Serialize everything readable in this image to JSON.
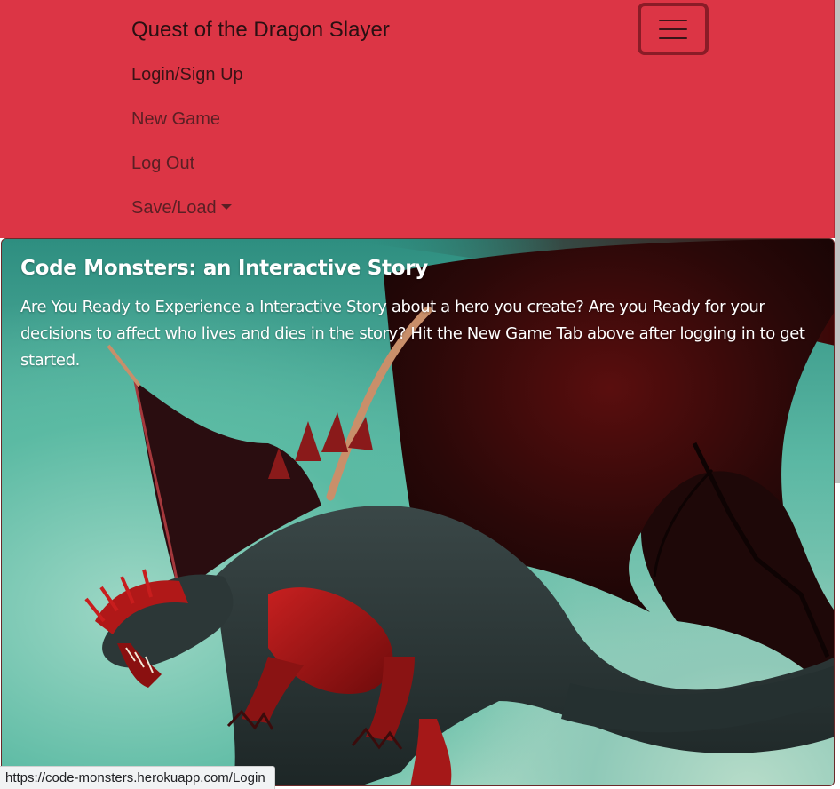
{
  "navbar": {
    "brand": "Quest of the Dragon Slayer",
    "toggler_icon": "hamburger-menu-icon",
    "background": "#dc3545",
    "items": [
      {
        "label": "Login/Sign Up"
      },
      {
        "label": "New Game"
      },
      {
        "label": "Log Out"
      },
      {
        "label": "Save/Load",
        "dropdown": true
      }
    ]
  },
  "hero": {
    "title": "Code Monsters: an Interactive Story",
    "text": "Are You Ready to Experience a Interactive Story about a hero you create? Are you Ready for your decisions to affect who lives and dies in the story? Hit the New Game Tab above after logging in to get started.",
    "image": "red-black-dragon-illustration"
  },
  "status_bar": {
    "url": "https://code-monsters.herokuapp.com/Login"
  }
}
